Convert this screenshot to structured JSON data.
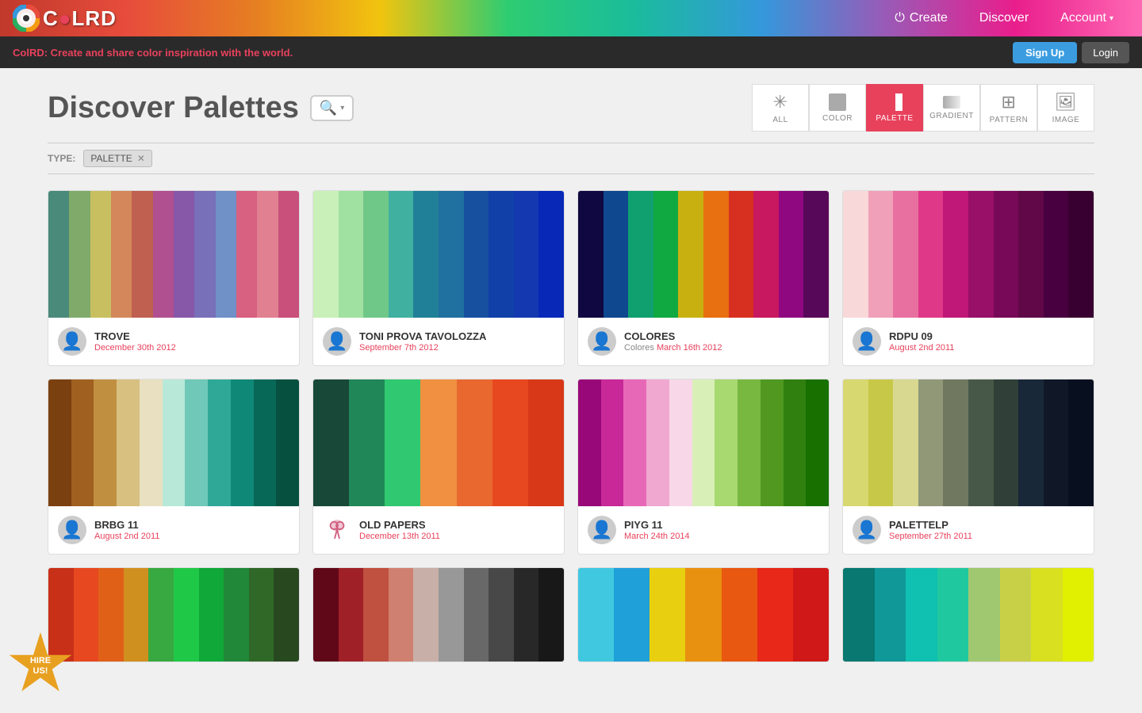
{
  "header": {
    "logo_text": "C●LRD",
    "logo_display": "COLRD",
    "nav": {
      "create_label": "Create",
      "discover_label": "Discover",
      "account_label": "Account"
    }
  },
  "signin_bar": {
    "text_prefix": "ColRD:",
    "text_body": " Create and share color inspiration with the world.",
    "signup_label": "Sign Up",
    "login_label": "Login"
  },
  "page": {
    "title": "Discover Palettes",
    "search_placeholder": "Search"
  },
  "filter_tabs": [
    {
      "id": "all",
      "icon": "✳",
      "label": "ALL",
      "active": false
    },
    {
      "id": "color",
      "icon": "▣",
      "label": "COLOR",
      "active": false
    },
    {
      "id": "palette",
      "icon": "▐▌",
      "label": "PALETTE",
      "active": true
    },
    {
      "id": "gradient",
      "icon": "▭",
      "label": "GRADIENT",
      "active": false
    },
    {
      "id": "pattern",
      "icon": "⊞",
      "label": "PATTERN",
      "active": false
    },
    {
      "id": "image",
      "icon": "🖼",
      "label": "IMAGE",
      "active": false
    }
  ],
  "type_filter": {
    "label": "TYPE:",
    "tag": "PALETTE"
  },
  "palettes": [
    {
      "id": "trove",
      "name": "TROVE",
      "date": "December 30th 2012",
      "avatar_type": "person",
      "swatches": [
        "#4a8a7a",
        "#7faa6a",
        "#c8c060",
        "#d4875a",
        "#c06050",
        "#b05090",
        "#8858a8",
        "#7870b8",
        "#7090c8",
        "#d86080",
        "#e08090",
        "#c8507a"
      ]
    },
    {
      "id": "toni-prova",
      "name": "TONI PROVA TAVOLOZZA",
      "date": "September 7th 2012",
      "avatar_type": "person",
      "swatches": [
        "#c8f0b8",
        "#a0e0a0",
        "#70c888",
        "#40b0a0",
        "#208098",
        "#2070a0",
        "#1850a0",
        "#1040a8",
        "#1438b0",
        "#0828b8"
      ]
    },
    {
      "id": "colores",
      "name": "COLORES",
      "sub_prefix": "Colores",
      "date": "March 16th 2012",
      "avatar_type": "person",
      "swatches": [
        "#100840",
        "#104890",
        "#10a070",
        "#10a840",
        "#c8b010",
        "#e87010",
        "#d83020",
        "#c81860",
        "#900880",
        "#580858"
      ]
    },
    {
      "id": "rdpu09",
      "name": "RDPU 09",
      "date": "August 2nd 2011",
      "avatar_type": "person",
      "swatches": [
        "#f8d8d8",
        "#f0a0b8",
        "#e870a0",
        "#e03888",
        "#c01878",
        "#981068",
        "#780858",
        "#600848",
        "#480040",
        "#380030"
      ]
    },
    {
      "id": "brbg11",
      "name": "BRBG 11",
      "date": "August 2nd 2011",
      "avatar_type": "person",
      "swatches": [
        "#7a4010",
        "#a06020",
        "#c09040",
        "#d8c080",
        "#e8e0c0",
        "#b8e8d8",
        "#70c8b8",
        "#30a898",
        "#108878",
        "#086858",
        "#065040"
      ]
    },
    {
      "id": "old-papers",
      "name": "OLD PAPERS",
      "date": "December 13th 2011",
      "avatar_type": "ribbon",
      "swatches": [
        "#184838",
        "#208858",
        "#30c870",
        "#f09040",
        "#e86830",
        "#e84820",
        "#d83818"
      ]
    },
    {
      "id": "piyg11",
      "name": "PIYG 11",
      "date": "March 24th 2014",
      "avatar_type": "person",
      "swatches": [
        "#980878",
        "#c82898",
        "#e868b8",
        "#f0a8d0",
        "#f8d8e8",
        "#d8f0b8",
        "#a8d870",
        "#78b840",
        "#509820",
        "#308010",
        "#187000"
      ]
    },
    {
      "id": "palettelp",
      "name": "PALETTELP",
      "date": "September 27th 2011",
      "avatar_type": "person",
      "swatches": [
        "#d8d870",
        "#c8c848",
        "#d8d890",
        "#909878",
        "#707860",
        "#485848",
        "#304038",
        "#182838",
        "#101828",
        "#081020"
      ]
    },
    {
      "id": "partial1",
      "name": "",
      "date": "",
      "avatar_type": "none",
      "partial": true,
      "swatches": [
        "#c83018",
        "#e84820",
        "#e06018",
        "#d09020",
        "#38a840",
        "#20c848",
        "#10a838",
        "#208838",
        "#306828",
        "#284820"
      ]
    },
    {
      "id": "partial2",
      "name": "",
      "date": "",
      "avatar_type": "none",
      "partial": true,
      "swatches": [
        "#600818",
        "#a02028",
        "#c05040",
        "#d08070",
        "#c8b0a8",
        "#989898",
        "#686868",
        "#484848",
        "#282828",
        "#181818"
      ]
    },
    {
      "id": "partial3",
      "name": "",
      "date": "",
      "avatar_type": "none",
      "partial": true,
      "swatches": [
        "#40c8e0",
        "#20a0d8",
        "#e8d010",
        "#e89010",
        "#e85810",
        "#e82818",
        "#d01818"
      ]
    },
    {
      "id": "partial4",
      "name": "",
      "date": "",
      "avatar_type": "none",
      "partial": true,
      "swatches": [
        "#087870",
        "#109898",
        "#10c0b0",
        "#20c8a0",
        "#a0c870",
        "#c8d048",
        "#d8e020",
        "#e0f000"
      ]
    }
  ],
  "hire": {
    "label": "HIRE\nUS!"
  }
}
